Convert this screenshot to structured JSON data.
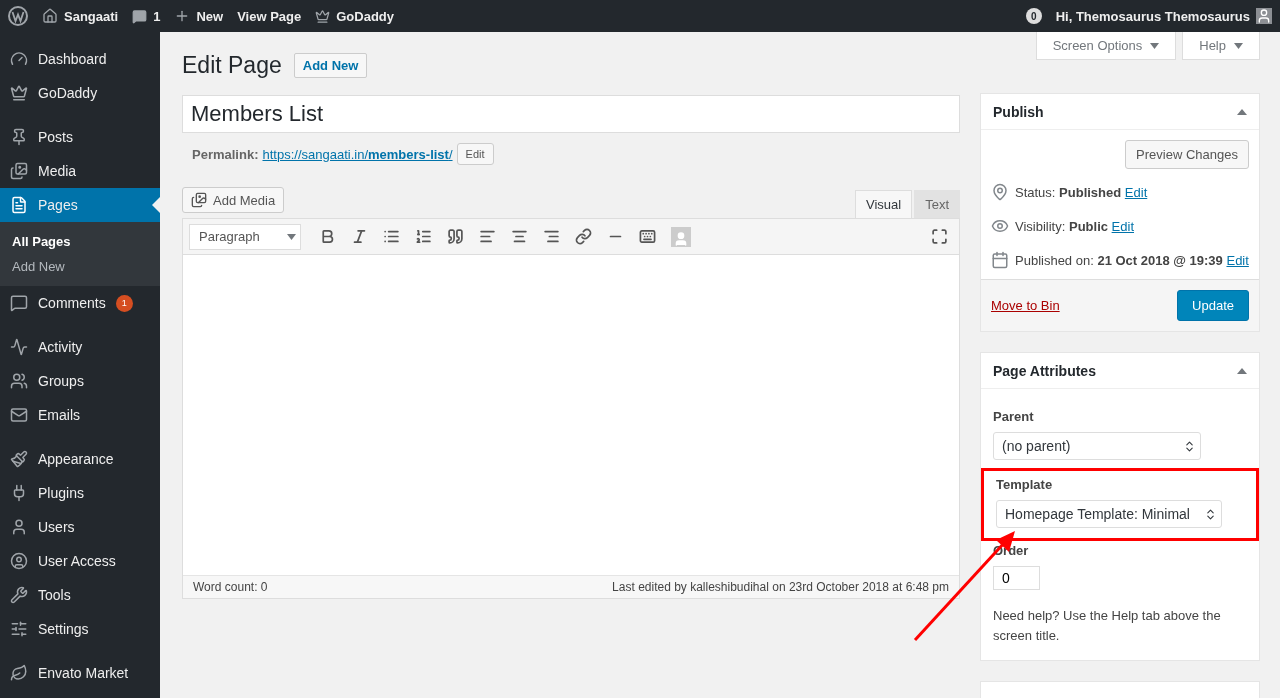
{
  "admin_bar": {
    "site": "Sangaati",
    "comments": "1",
    "new": "New",
    "view": "View Page",
    "godaddy": "GoDaddy",
    "notifications": "0",
    "greeting": "Hi, Themosaurus Themosaurus"
  },
  "sidebar": {
    "groups": [
      [
        {
          "label": "Dashboard",
          "selected": false
        },
        {
          "label": "GoDaddy",
          "selected": false
        }
      ],
      [
        {
          "label": "Posts",
          "selected": false
        },
        {
          "label": "Media",
          "selected": false
        },
        {
          "label": "Pages",
          "selected": true,
          "submenu": [
            {
              "label": "All Pages",
              "selected": true
            },
            {
              "label": "Add New",
              "selected": false
            }
          ]
        },
        {
          "label": "Comments",
          "selected": false,
          "badge": "1"
        }
      ],
      [
        {
          "label": "Activity",
          "selected": false
        },
        {
          "label": "Groups",
          "selected": false
        },
        {
          "label": "Emails",
          "selected": false
        }
      ],
      [
        {
          "label": "Appearance",
          "selected": false
        },
        {
          "label": "Plugins",
          "selected": false
        },
        {
          "label": "Users",
          "selected": false
        },
        {
          "label": "User Access",
          "selected": false
        },
        {
          "label": "Tools",
          "selected": false
        },
        {
          "label": "Settings",
          "selected": false
        }
      ],
      [
        {
          "label": "Envato Market",
          "selected": false
        }
      ]
    ]
  },
  "screen_meta": {
    "buttons": [
      "Screen Options",
      "Help"
    ]
  },
  "heading": {
    "title": "Edit Page",
    "add_new": "Add New"
  },
  "title_field": {
    "value": "Members List"
  },
  "permalink": {
    "label": "Permalink:",
    "url": "https://sangaati.in/**members-list**/",
    "edit": "Edit"
  },
  "editor": {
    "add_media": "Add Media",
    "tabs": [
      {
        "label": "Visual",
        "selected": true
      },
      {
        "label": "Text",
        "selected": false
      }
    ],
    "format": "Paragraph",
    "word_count": "Word count: 0",
    "last_edited": "Last edited by kalleshibudihal on 23rd October 2018 at 6:48 pm"
  },
  "publish": {
    "title": "Publish",
    "preview": "Preview Changes",
    "rows": [
      {
        "label": "Status:",
        "value": "Published",
        "edit": "Edit"
      },
      {
        "label": "Visibility:",
        "value": "Public",
        "edit": "Edit"
      },
      {
        "label": "Published on:",
        "value": "21 Oct 2018 @ 19:39",
        "edit": "Edit"
      }
    ],
    "trash": "Move to Bin",
    "update": "Update"
  },
  "attributes": {
    "title": "Page Attributes",
    "parent_label": "Parent",
    "parent": "(no parent)",
    "template_label": "Template",
    "template": "Homepage Template: Minimal",
    "template_highlighted": true,
    "order_label": "Order",
    "order": "0",
    "help": "Need help? Use the Help tab above the screen title."
  }
}
